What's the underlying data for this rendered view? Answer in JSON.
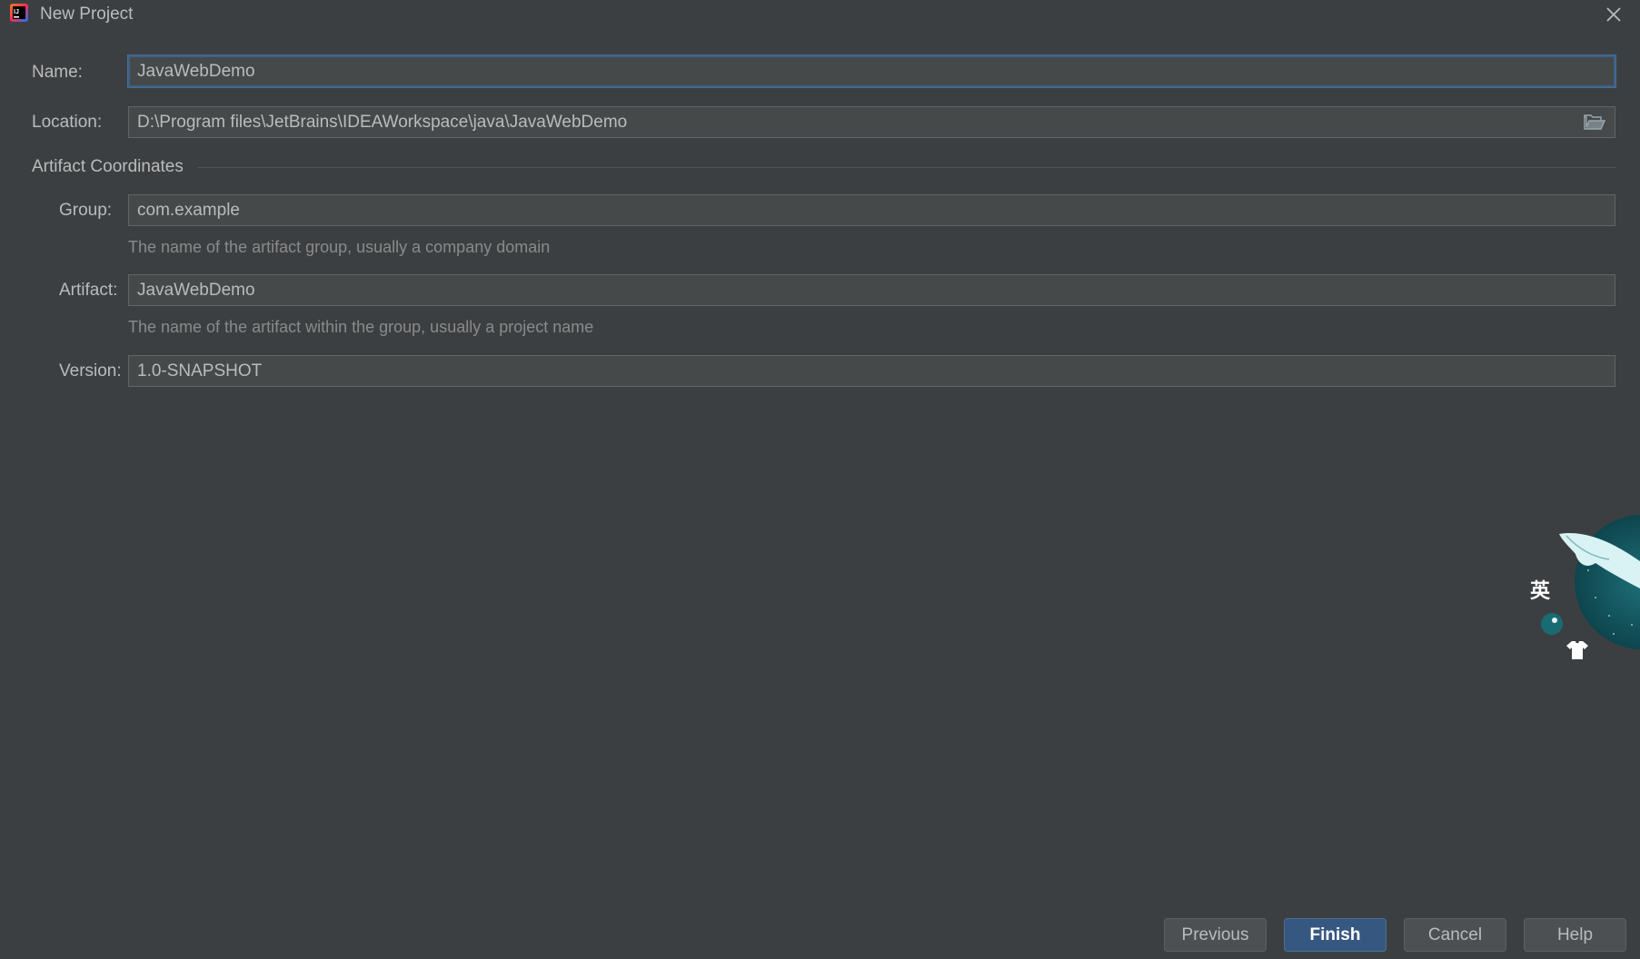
{
  "window": {
    "title": "New Project",
    "close_icon": "close-icon",
    "app_icon": "intellij-idea-icon"
  },
  "form": {
    "name_label": "Name:",
    "name_value": "JavaWebDemo",
    "location_label": "Location:",
    "location_value": "D:\\Program files\\JetBrains\\IDEAWorkspace\\java\\JavaWebDemo",
    "browse_icon": "folder-icon"
  },
  "artifact": {
    "section_title": "Artifact Coordinates",
    "group_label": "Group:",
    "group_value": "com.example",
    "group_hint": "The name of the artifact group, usually a company domain",
    "artifact_label": "Artifact:",
    "artifact_value": "JavaWebDemo",
    "artifact_hint": "The name of the artifact within the group, usually a project name",
    "version_label": "Version:",
    "version_value": "1.0-SNAPSHOT"
  },
  "buttons": {
    "previous": "Previous",
    "finish": "Finish",
    "cancel": "Cancel",
    "help": "Help"
  },
  "ime_widget": {
    "lang_char": "英",
    "icons": [
      "whale-icon",
      "moon-icon",
      "shirt-icon"
    ]
  },
  "colors": {
    "background": "#3c3f41",
    "field_bg": "#45494a",
    "focus_border": "#3d6185",
    "primary_button": "#365880"
  }
}
